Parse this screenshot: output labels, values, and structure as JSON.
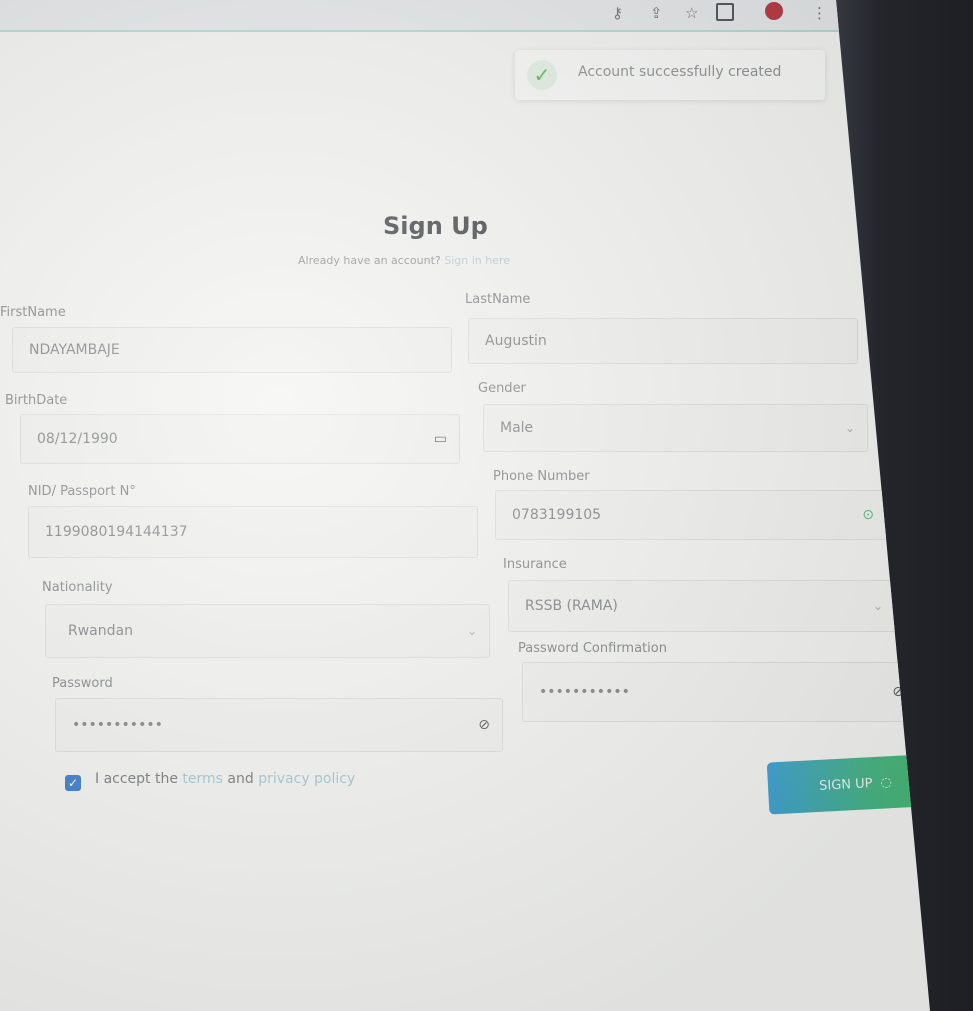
{
  "toast": {
    "icon": "check-icon",
    "message": "Account successfully created"
  },
  "header": {
    "title": "Sign Up",
    "subtitle": "Already have an account?",
    "signin_link": "Sign in here"
  },
  "form": {
    "firstname": {
      "label": "FirstName",
      "value": "NDAYAMBAJE"
    },
    "lastname": {
      "label": "LastName",
      "value": "Augustin"
    },
    "birthdate": {
      "label": "BirthDate",
      "value": "08/12/1990"
    },
    "gender": {
      "label": "Gender",
      "value": "Male"
    },
    "nid": {
      "label": "NID/ Passport N°",
      "value": "1199080194144137"
    },
    "phone": {
      "label": "Phone Number",
      "value": "0783199105"
    },
    "nationality": {
      "label": "Nationality",
      "value": "Rwandan"
    },
    "insurance": {
      "label": "Insurance",
      "value": "RSSB (RAMA)"
    },
    "password": {
      "label": "Password",
      "value": "•••••••••••"
    },
    "password_confirm": {
      "label": "Password Confirmation",
      "value": "•••••••••••"
    }
  },
  "terms": {
    "checked": true,
    "prefix": "I accept the",
    "terms_link": "terms",
    "and": "and",
    "privacy_link": "privacy policy"
  },
  "submit": {
    "label": "SIGN UP"
  },
  "colors": {
    "accent_blue": "#3a9fd0",
    "accent_green": "#4cba6a",
    "toast_check": "#55b64c"
  }
}
